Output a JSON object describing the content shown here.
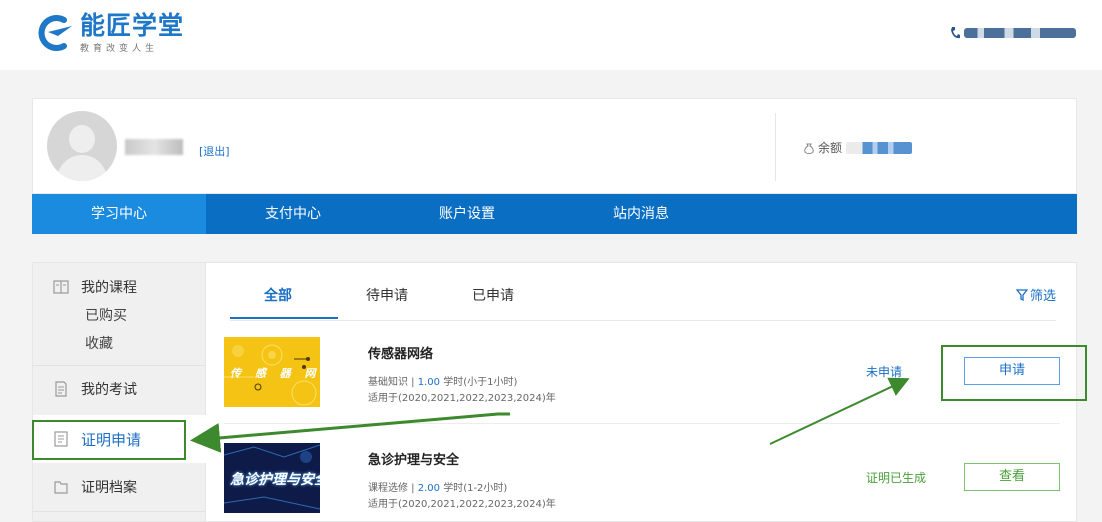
{
  "header": {
    "brand_title": "能匠学堂",
    "brand_slogan": "教育改变人生"
  },
  "profile": {
    "logout_label": "[退出]",
    "balance_label": "余额"
  },
  "nav": {
    "items": [
      {
        "label": "学习中心",
        "active": true
      },
      {
        "label": "支付中心",
        "active": false
      },
      {
        "label": "账户设置",
        "active": false
      },
      {
        "label": "站内消息",
        "active": false
      }
    ]
  },
  "sidebar": {
    "my_courses": "我的课程",
    "purchased": "已购买",
    "favorites": "收藏",
    "my_exams": "我的考试",
    "certificate_apply": "证明申请",
    "certificate_archive": "证明档案"
  },
  "tabs": {
    "all": "全部",
    "pending": "待申请",
    "applied": "已申请",
    "filter_label": "筛选"
  },
  "courses": [
    {
      "thumb_text": "传 感 器 网 络",
      "title": "传感器网络",
      "category": "基础知识",
      "hours": "1.00",
      "hours_unit": "学时",
      "duration_note": "(小于1小时)",
      "years": "适用于(2020,2021,2022,2023,2024)年",
      "status": "未申请",
      "action": "申请"
    },
    {
      "thumb_text": "急诊护理与安全",
      "title": "急诊护理与安全",
      "category": "课程选修",
      "hours": "2.00",
      "hours_unit": "学时",
      "duration_note": "(1-2小时)",
      "years": "适用于(2020,2021,2022,2023,2024)年",
      "status": "证明已生成",
      "action": "查看"
    }
  ],
  "colors": {
    "brand_blue": "#0a6fc2",
    "nav_active": "#1b8be0",
    "link_blue": "#1b6fc6",
    "success_green": "#4aa03a",
    "annotation_green": "#3d8a2e"
  }
}
